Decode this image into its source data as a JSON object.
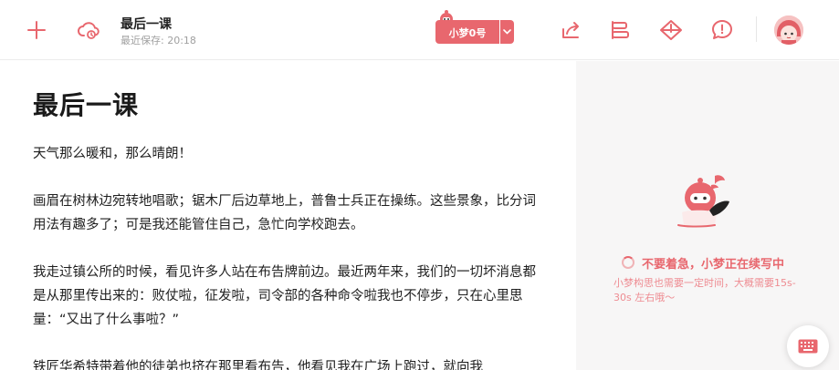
{
  "header": {
    "doc_title": "最后一课",
    "saved_status": "最近保存: 20:18",
    "model_label": "小梦0号",
    "icons": {
      "add": "plus-icon",
      "cloud": "cloud-sync-icon",
      "share": "share-icon",
      "outline": "outline-icon",
      "diamond": "diamond-icon",
      "feedback": "feedback-icon",
      "avatar": "avatar"
    }
  },
  "document": {
    "title": "最后一课",
    "paragraphs": [
      "天气那么暖和，那么晴朗！",
      "画眉在树林边宛转地唱歌；锯木厂后边草地上，普鲁士兵正在操练。这些景象，比分词用法有趣多了；可是我还能管住自己，急忙向学校跑去。",
      "我走过镇公所的时候，看见许多人站在布告牌前边。最近两年来，我们的一切坏消息都是从那里传出来的：败仗啦，征发啦，司令部的各种命令啦我也不停步，只在心里思量：“又出了什么事啦？”",
      "铁匠华希特带着他的徒弟也挤在那里看布告，他看见我在广场上跑过，就向我"
    ]
  },
  "side_panel": {
    "status_main": "不要着急，小梦正在续写中",
    "status_sub": "小梦构思也需要一定时间，大概需要15s-30s 左右哦～"
  },
  "colors": {
    "accent": "#e8676e",
    "side_bg": "#f7f6f6"
  }
}
